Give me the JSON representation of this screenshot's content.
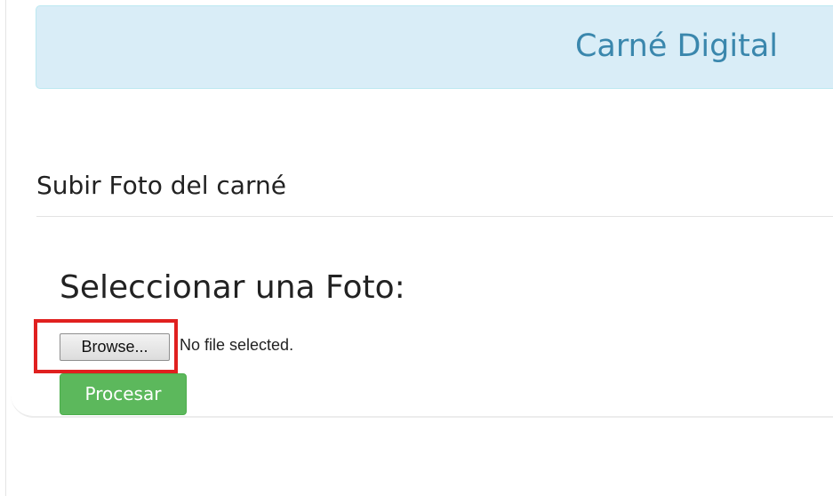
{
  "header": {
    "title": "Carné Digital"
  },
  "section": {
    "title": "Subir Foto del carné"
  },
  "upload": {
    "heading": "Seleccionar una Foto:",
    "browse_label": "Browse...",
    "file_status": "No file selected.",
    "submit_label": "Procesar"
  },
  "colors": {
    "banner_background": "#d9edf7",
    "banner_text": "#3a87ad",
    "submit_button": "#5cb85c",
    "highlight_outline": "#e0201f"
  }
}
